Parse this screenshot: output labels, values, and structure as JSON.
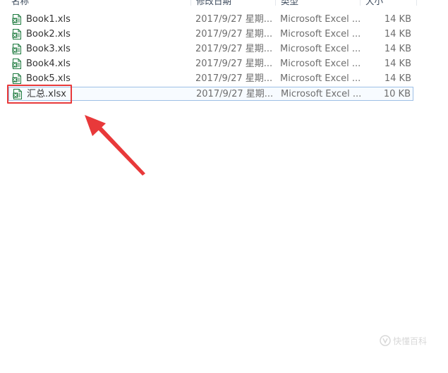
{
  "header": {
    "columns": [
      {
        "label": "名称"
      },
      {
        "label": "修改日期"
      },
      {
        "label": "类型"
      },
      {
        "label": "大小"
      }
    ]
  },
  "files": [
    {
      "name": "Book1.xls",
      "date": "2017/9/27 星期...",
      "type": "Microsoft Excel ...",
      "size": "14 KB",
      "icon": "excel-file-icon",
      "selected": false
    },
    {
      "name": "Book2.xls",
      "date": "2017/9/27 星期...",
      "type": "Microsoft Excel ...",
      "size": "14 KB",
      "icon": "excel-file-icon",
      "selected": false
    },
    {
      "name": "Book3.xls",
      "date": "2017/9/27 星期...",
      "type": "Microsoft Excel ...",
      "size": "14 KB",
      "icon": "excel-file-icon",
      "selected": false
    },
    {
      "name": "Book4.xls",
      "date": "2017/9/27 星期...",
      "type": "Microsoft Excel ...",
      "size": "14 KB",
      "icon": "excel-file-icon",
      "selected": false
    },
    {
      "name": "Book5.xls",
      "date": "2017/9/27 星期...",
      "type": "Microsoft Excel ...",
      "size": "14 KB",
      "icon": "excel-file-icon",
      "selected": false
    },
    {
      "name": "汇总.xlsx",
      "date": "2017/9/27 星期...",
      "type": "Microsoft Excel ...",
      "size": "10 KB",
      "icon": "excel-file-icon",
      "selected": true
    }
  ],
  "annotations": {
    "highlight_color": "#e8393a",
    "arrow_icon": "red-arrow-icon"
  },
  "colors": {
    "selection_border": "#9ec0e6",
    "selection_fill": "#f7fbff",
    "excel_green": "#1d7a3e"
  },
  "watermark": {
    "text": "快懂百科",
    "icon": "watermark-logo-icon"
  }
}
